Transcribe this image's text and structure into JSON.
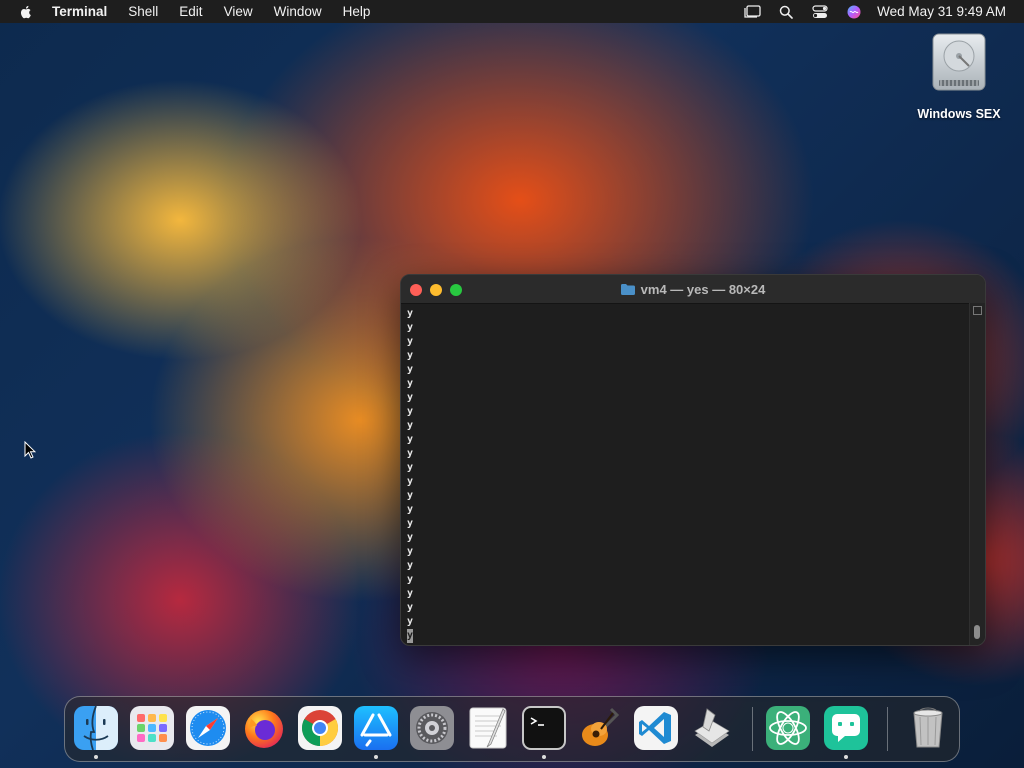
{
  "menubar": {
    "app_name": "Terminal",
    "items": [
      "Shell",
      "Edit",
      "View",
      "Window",
      "Help"
    ],
    "clock": "Wed May 31  9:49 AM"
  },
  "desktop": {
    "drive_label": "Windows SEX"
  },
  "terminal": {
    "title": "vm4 — yes — 80×24",
    "lines": [
      "y",
      "y",
      "y",
      "y",
      "y",
      "y",
      "y",
      "y",
      "y",
      "y",
      "y",
      "y",
      "y",
      "y",
      "y",
      "y",
      "y",
      "y",
      "y",
      "y",
      "y",
      "y",
      "y"
    ],
    "last_line": "y"
  },
  "dock": {
    "apps": [
      "finder",
      "launchpad",
      "safari",
      "firefox",
      "chrome",
      "app-store",
      "system-settings",
      "textedit",
      "terminal",
      "garageband",
      "vscode",
      "script-editor",
      "ai-app",
      "chat-app",
      "trash"
    ],
    "running": [
      "finder",
      "app-store",
      "terminal",
      "chat-app"
    ]
  },
  "colors": {
    "menubar_bg": "#1e1e1e",
    "terminal_bg": "#1e1e1e",
    "close": "#ff5f57",
    "minimize": "#febc2e",
    "maximize": "#28c840"
  }
}
